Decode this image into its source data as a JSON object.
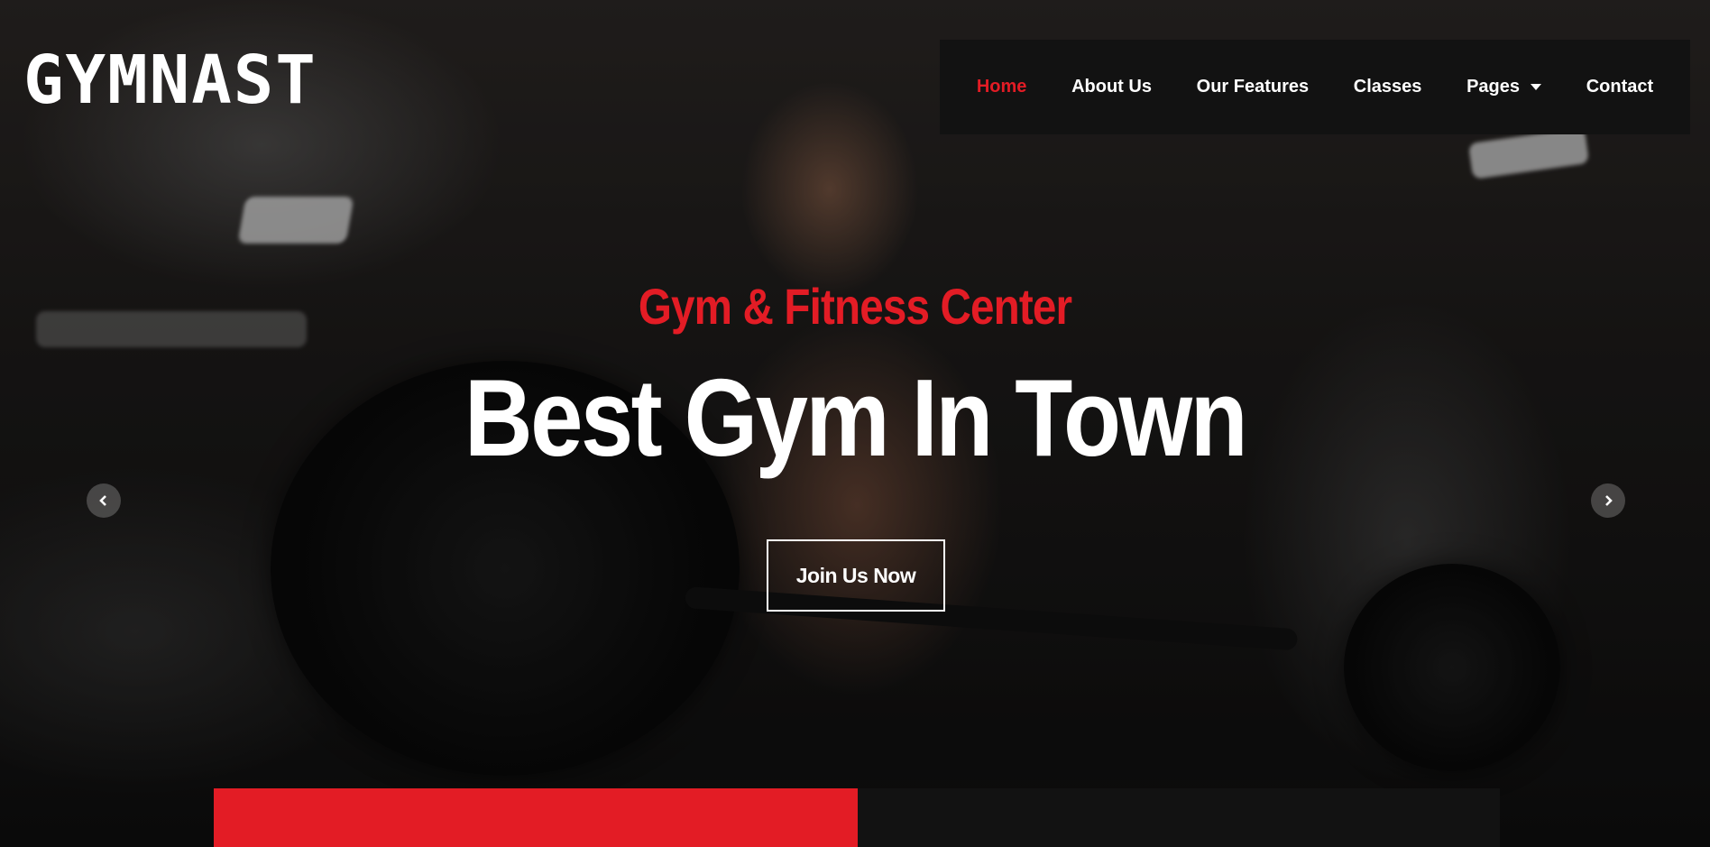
{
  "brand": {
    "logo_text": "GYMNAST"
  },
  "nav": {
    "items": [
      {
        "label": "Home",
        "active": true
      },
      {
        "label": "About Us",
        "active": false
      },
      {
        "label": "Our Features",
        "active": false
      },
      {
        "label": "Classes",
        "active": false
      },
      {
        "label": "Pages",
        "active": false,
        "has_dropdown": true
      },
      {
        "label": "Contact",
        "active": false
      }
    ]
  },
  "hero": {
    "subtitle": "Gym & Fitness Center",
    "title": "Best Gym In Town",
    "cta_label": "Join Us Now"
  },
  "carousel": {
    "prev_icon": "chevron-left-icon",
    "next_icon": "chevron-right-icon"
  },
  "colors": {
    "accent": "#e31c25",
    "nav_background": "#121212",
    "text_light": "#ffffff",
    "bottom_bar_left": "#e31c25",
    "bottom_bar_right": "#121212"
  }
}
